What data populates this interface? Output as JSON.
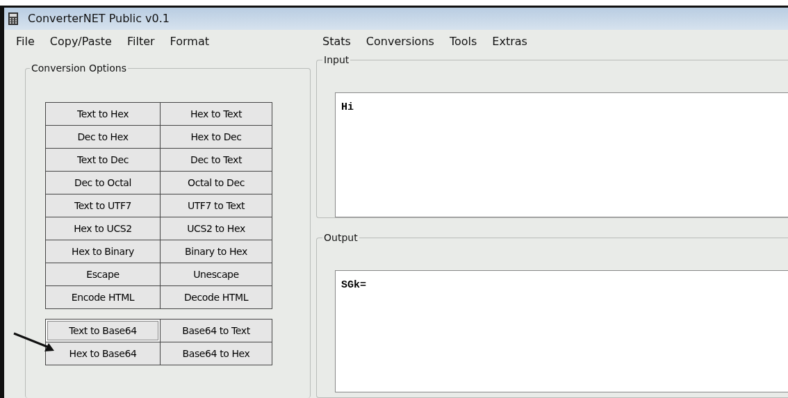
{
  "window": {
    "title": "ConverterNET Public v0.1"
  },
  "menu": [
    "File",
    "Copy/Paste",
    "Filter",
    "Format",
    "Stats",
    "Conversions",
    "Tools",
    "Extras"
  ],
  "conversion_options": {
    "title": "Conversion Options",
    "groups": [
      {
        "buttons": [
          {
            "label": "Text to Hex",
            "focused": false
          },
          {
            "label": "Hex to Text",
            "focused": false
          },
          {
            "label": "Dec to Hex",
            "focused": false
          },
          {
            "label": "Hex to Dec",
            "focused": false
          },
          {
            "label": "Text to Dec",
            "focused": false
          },
          {
            "label": "Dec to Text",
            "focused": false
          },
          {
            "label": "Dec to Octal",
            "focused": false
          },
          {
            "label": "Octal to Dec",
            "focused": false
          },
          {
            "label": "Text to UTF7",
            "focused": false
          },
          {
            "label": "UTF7 to Text",
            "focused": false
          },
          {
            "label": "Hex to UCS2",
            "focused": false
          },
          {
            "label": "UCS2 to Hex",
            "focused": false
          },
          {
            "label": "Hex to Binary",
            "focused": false
          },
          {
            "label": "Binary to Hex",
            "focused": false
          },
          {
            "label": "Escape",
            "focused": false
          },
          {
            "label": "Unescape",
            "focused": false
          },
          {
            "label": "Encode HTML",
            "focused": false
          },
          {
            "label": "Decode HTML",
            "focused": false
          }
        ]
      },
      {
        "buttons": [
          {
            "label": "Text to Base64",
            "focused": true
          },
          {
            "label": "Base64 to Text",
            "focused": false
          },
          {
            "label": "Hex to Base64",
            "focused": false
          },
          {
            "label": "Base64 to Hex",
            "focused": false
          }
        ]
      }
    ]
  },
  "input": {
    "title": "Input",
    "value": "Hi"
  },
  "output": {
    "title": "Output",
    "value": "SGk="
  }
}
